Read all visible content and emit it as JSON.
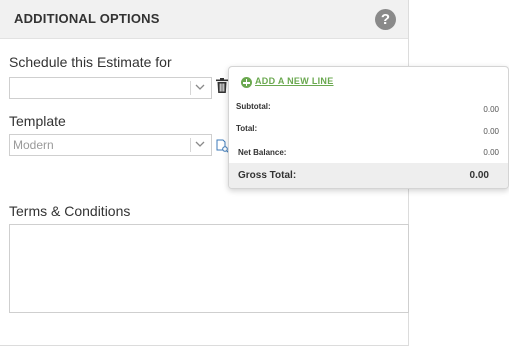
{
  "panel": {
    "title": "ADDITIONAL OPTIONS",
    "help_icon": "question-circle-icon"
  },
  "schedule": {
    "label": "Schedule this Estimate for",
    "value": ""
  },
  "template": {
    "label": "Template",
    "value": "Modern"
  },
  "terms": {
    "label": "Terms & Conditions",
    "value": ""
  },
  "totals": {
    "add_line_label": "ADD A NEW LINE",
    "subtotal_label": "Subtotal:",
    "subtotal_value": "0.00",
    "total_label": "Total:",
    "total_value": "0.00",
    "net_balance_label": "Net Balance:",
    "net_balance_value": "0.00",
    "gross_total_label": "Gross Total:",
    "gross_total_value": "0.00"
  },
  "colors": {
    "accent_green": "#6aa84f",
    "header_bg": "#f1f1f1"
  }
}
